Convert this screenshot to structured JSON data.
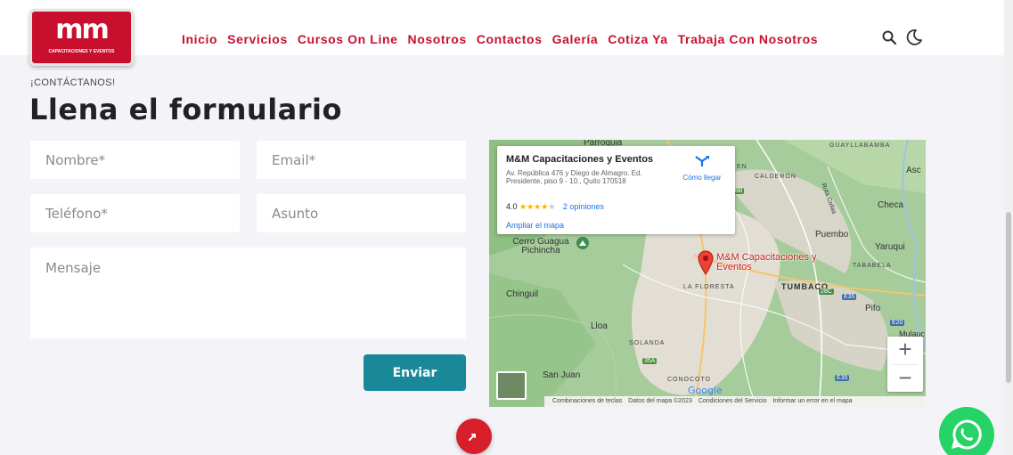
{
  "header": {
    "logo": {
      "mark": "mm",
      "subtitle": "CAPACITACIONES Y EVENTOS",
      "color": "#c8102e"
    },
    "nav": [
      "Inicio",
      "Servicios",
      "Cursos On Line",
      "Nosotros",
      "Contactos",
      "Galería",
      "Cotiza Ya",
      "Trabaja Con Nosotros"
    ],
    "icons": [
      "search-icon",
      "moon-icon"
    ]
  },
  "contact": {
    "kicker": "¡CONTÁCTANOS!",
    "title": "Llena el formulario",
    "fields": {
      "name": {
        "placeholder": "Nombre*",
        "value": ""
      },
      "email": {
        "placeholder": "Email*",
        "value": ""
      },
      "phone": {
        "placeholder": "Teléfono*",
        "value": ""
      },
      "subject": {
        "placeholder": "Asunto",
        "value": ""
      },
      "message": {
        "placeholder": "Mensaje",
        "value": ""
      }
    },
    "submit_label": "Enviar",
    "accent": "#19899a"
  },
  "map": {
    "info": {
      "name": "M&M Capacitaciones y Eventos",
      "address": "Av. República 476 y Diego de Almagro. Ed. Presidente, piso 9 - 10., Quito 170518",
      "rating": "4.0",
      "stars": 4,
      "reviews": "2 opiniones",
      "directions": "Cómo llegar",
      "enlarge": "Ampliar el mapa"
    },
    "labels": {
      "parroquia": "Parroquia",
      "guayllabamba": "GUAYLLABAMBA",
      "calderon": "CALDERÓN",
      "asc": "Asc",
      "ruta": "Ruta Collas",
      "checa": "Checa",
      "puembo": "Puembo",
      "yaruqui": "Yaruqui",
      "tababela": "TABABELA",
      "cerro": "Cerro Guagua Pichincha",
      "laFloresta": "LA FLORESTA",
      "tumbaco": "TUMBACO",
      "pifo": "Pifo",
      "mulauco": "Mulauc",
      "chinguil": "Chinguil",
      "lloa": "Lloa",
      "solanda": "SOLANDA",
      "sanJuan": "San Juan",
      "conocoto": "CONOCOTO",
      "en": "EN"
    },
    "pin_label": "M&M Capacitaciones y Eventos",
    "shields": [
      "28B",
      "28C",
      "E35",
      "E20",
      "35A",
      "E35"
    ],
    "zoom_in": "+",
    "zoom_out": "−",
    "google": "Google",
    "footer": [
      "Combinaciones de teclas",
      "Datos del mapa ©2023",
      "Condiciones del Servicio",
      "Informar un error en el mapa"
    ]
  },
  "floating": {
    "scroll_top_color": "#d71f2b",
    "whatsapp_color": "#25d366"
  }
}
